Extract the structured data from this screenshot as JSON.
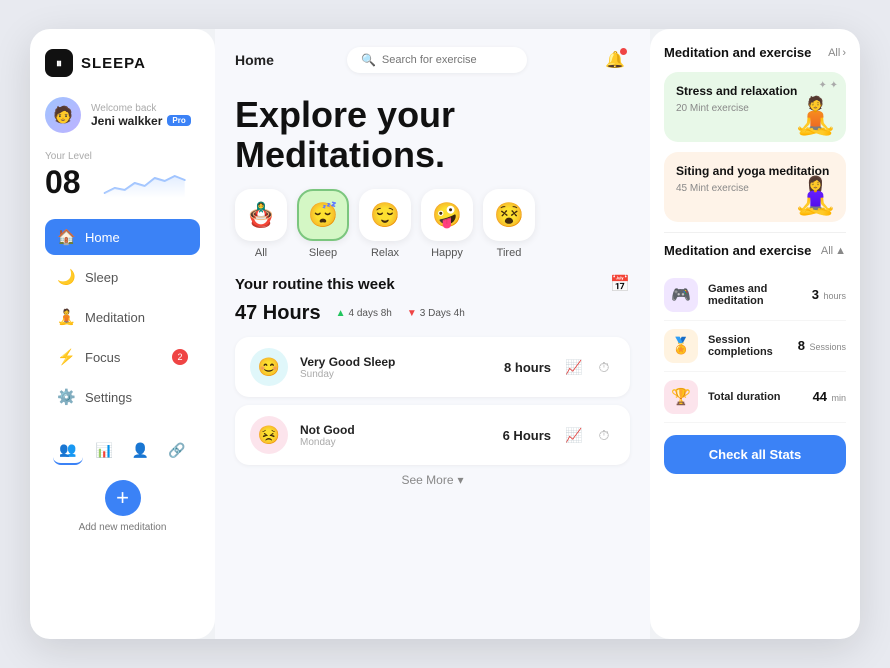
{
  "app": {
    "name": "SLEEPA",
    "logo_symbol": "⏸"
  },
  "user": {
    "welcome": "Welcome back",
    "name": "Jeni walkker",
    "badge": "Pro",
    "avatar_emoji": "🧑"
  },
  "level": {
    "label": "Your Level",
    "value": "08"
  },
  "nav": {
    "items": [
      {
        "id": "home",
        "label": "Home",
        "icon": "🏠",
        "active": true,
        "badge": null
      },
      {
        "id": "sleep",
        "label": "Sleep",
        "icon": "🌙",
        "active": false,
        "badge": null
      },
      {
        "id": "meditation",
        "label": "Meditation",
        "icon": "🧘",
        "active": false,
        "badge": null
      },
      {
        "id": "focus",
        "label": "Focus",
        "icon": "⚡",
        "active": false,
        "badge": "2"
      },
      {
        "id": "settings",
        "label": "Settings",
        "icon": "⚙️",
        "active": false,
        "badge": null
      }
    ]
  },
  "add_meditation": {
    "label": "Add new meditation"
  },
  "header": {
    "page_title": "Home",
    "search_placeholder": "Search for exercise"
  },
  "hero": {
    "title_line1": "Explore your",
    "title_line2": "Meditations."
  },
  "moods": [
    {
      "id": "all",
      "emoji": "🪆",
      "label": "All",
      "selected": false
    },
    {
      "id": "sleep",
      "emoji": "😴",
      "label": "Sleep",
      "selected": true
    },
    {
      "id": "relax",
      "emoji": "😌",
      "label": "Relax",
      "selected": false
    },
    {
      "id": "happy",
      "emoji": "🤪",
      "label": "Happy",
      "selected": false
    },
    {
      "id": "tired",
      "emoji": "😵",
      "label": "Tired",
      "selected": false
    }
  ],
  "routine": {
    "title": "Your routine this week",
    "total_hours": "47 Hours",
    "stat_up": "4 days 8h",
    "stat_down": "3 Days 4h",
    "items": [
      {
        "name": "Very Good Sleep",
        "day": "Sunday",
        "hours": "8 hours",
        "emoji": "😊",
        "bg": "#e0f7fa"
      },
      {
        "name": "Not Good",
        "day": "Monday",
        "hours": "6 Hours",
        "emoji": "😣",
        "bg": "#fce4ec"
      }
    ],
    "see_more": "See More"
  },
  "right_panel": {
    "section1": {
      "title": "Meditation and exercise",
      "all_label": "All",
      "cards": [
        {
          "title": "Stress and relaxation",
          "subtitle": "20 Mint exercise",
          "emoji": "🧘",
          "style": "green"
        },
        {
          "title": "Siting and yoga meditation",
          "subtitle": "45 Mint exercise",
          "emoji": "🧘‍♀️",
          "style": "peach"
        }
      ]
    },
    "section2": {
      "title": "Meditation and exercise",
      "all_label": "All",
      "stats": [
        {
          "icon": "🎮",
          "name": "Games and meditation",
          "value": "3",
          "unit": "hours",
          "bg": "#f0e6ff"
        },
        {
          "icon": "🏅",
          "name": "Session completions",
          "value": "8",
          "unit": "Sessions",
          "bg": "#fff3e0"
        },
        {
          "icon": "🏆",
          "name": "Total duration",
          "value": "44",
          "unit": "min",
          "bg": "#fce4ec"
        }
      ]
    },
    "check_stats_label": "Check all Stats"
  }
}
